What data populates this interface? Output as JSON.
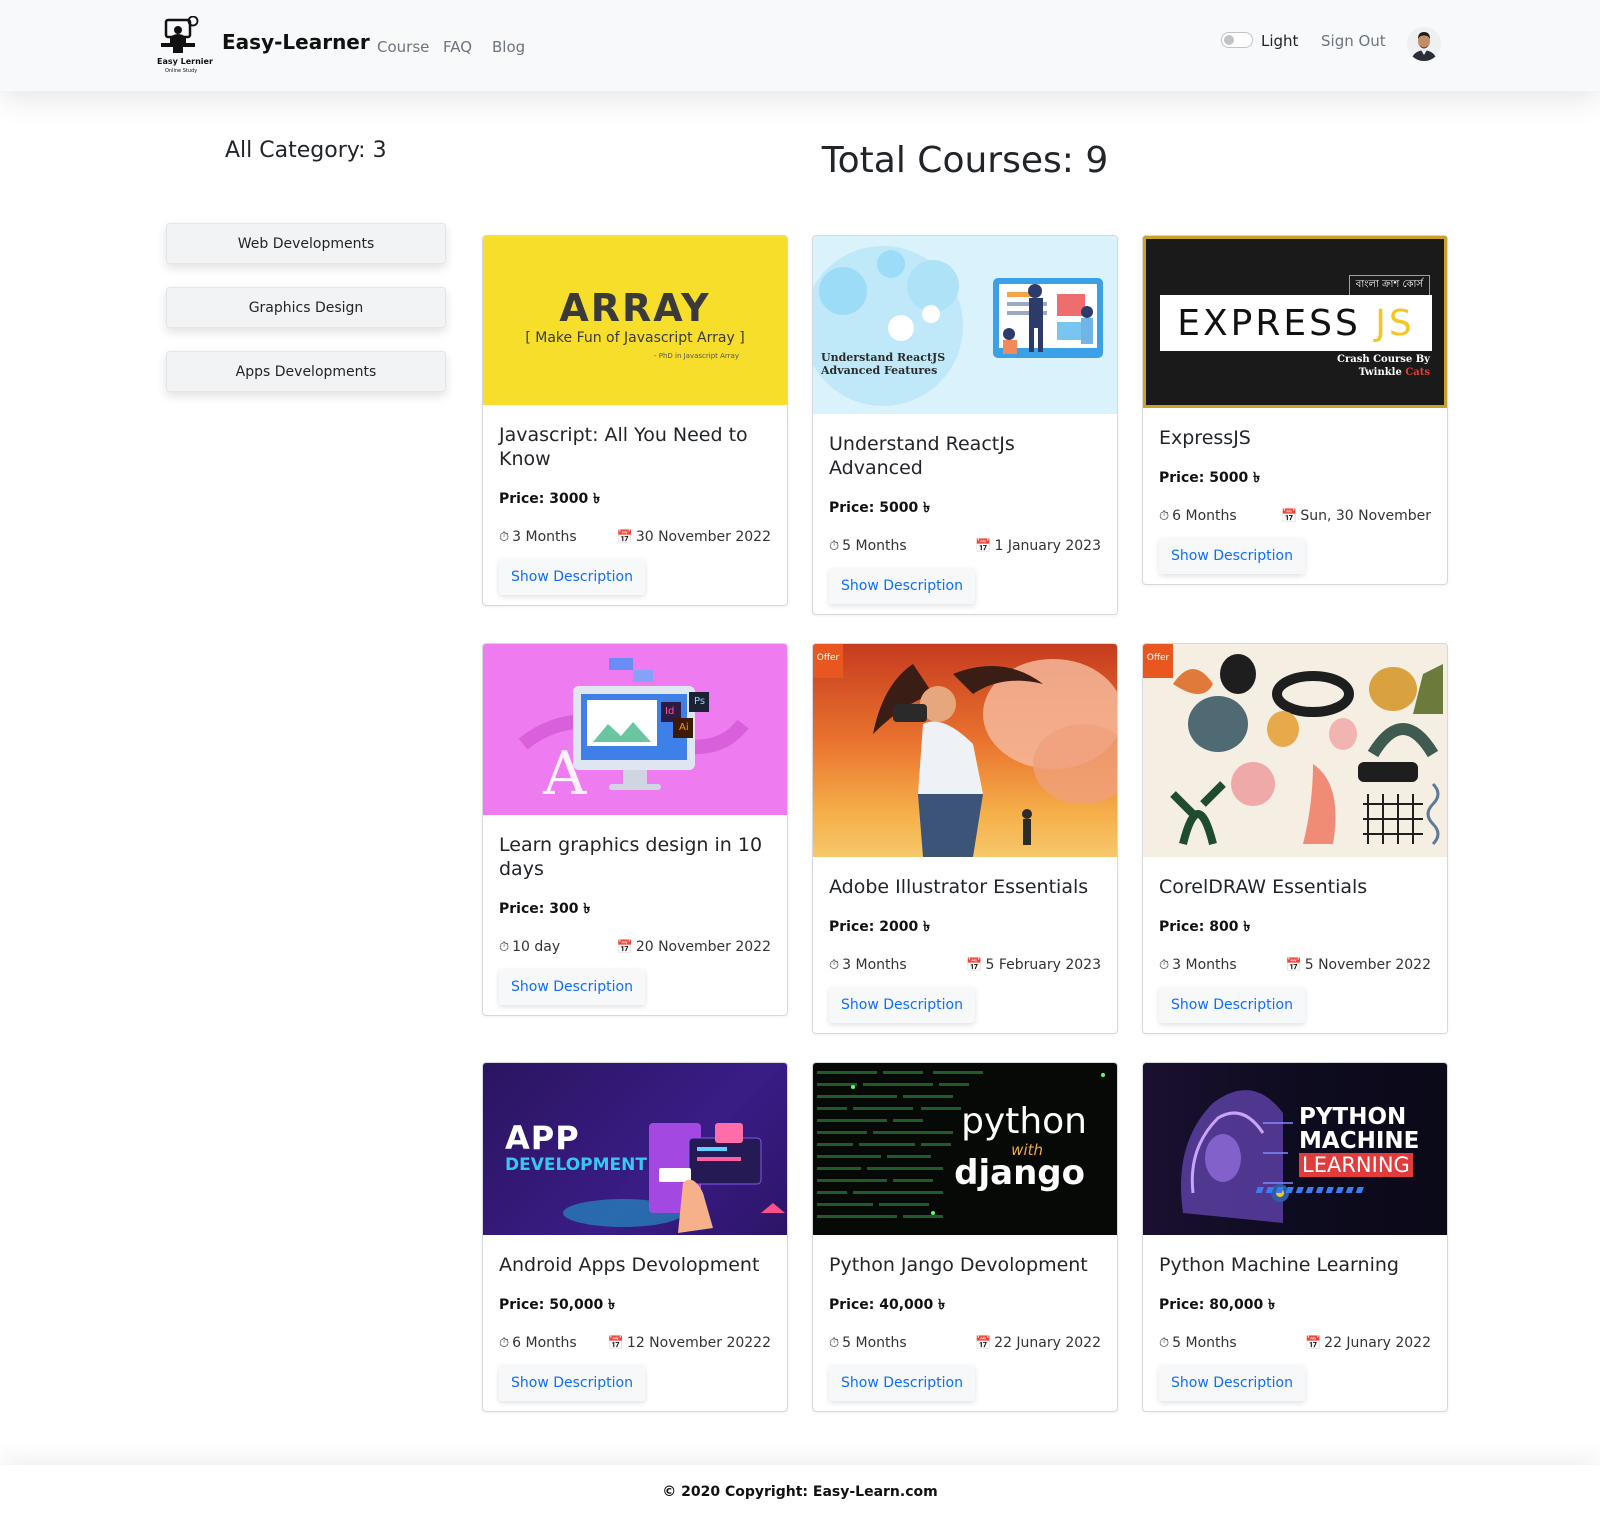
{
  "nav": {
    "brand": "Easy-Learner",
    "logo_line1": "Easy Lernier",
    "logo_line2": "Online Study",
    "links": [
      "Course",
      "FAQ",
      "Blog"
    ],
    "theme_label": "Light",
    "theme_on": false,
    "signout": "Sign Out"
  },
  "sidebar": {
    "category_count": "All Category: 3",
    "categories": [
      "Web Developments",
      "Graphics Design",
      "Apps Developments"
    ]
  },
  "total": "Total Courses: 9",
  "button_label": "Show Description",
  "offer_label": "Offer",
  "courses": [
    {
      "title": "Javascript: All You Need to Know",
      "price": "Price: 3000 ৳",
      "duration": "3 Months",
      "date": "30 November 2022",
      "image": {
        "big": "ARRAY",
        "sub": "[ Make Fun of Javascript Array ]",
        "small": "- PhD in Javascript Array"
      }
    },
    {
      "title": "Understand ReactJs Advanced",
      "price": "Price: 5000 ৳",
      "duration": "5 Months",
      "date": "1 January 2023",
      "image": {
        "line1": "Understand ReactJS",
        "line2": "Advanced Features"
      }
    },
    {
      "title": "ExpressJS",
      "price": "Price: 5000 ৳",
      "duration": "6 Months",
      "date": "Sun, 30 November",
      "image": {
        "badge": "বাংলা ক্রাশ কোর্স",
        "big": "EXPRESS",
        "big_accent": "JS",
        "by1": "Crash Course By",
        "by2": "Twinkle",
        "by2_accent": "Cats"
      }
    },
    {
      "title": "Learn graphics design in 10 days",
      "price": "Price: 300 ৳",
      "duration": "10 day",
      "date": "20 November 2022",
      "image": {
        "ps": "Ps",
        "ai": "Ai",
        "id": "Id"
      }
    },
    {
      "title": "Adobe Illustrator Essentials",
      "price": "Price: 2000 ৳",
      "duration": "3 Months",
      "date": "5 February 2023",
      "offer": true
    },
    {
      "title": "CorelDRAW Essentials",
      "price": "Price: 800 ৳",
      "duration": "3 Months",
      "date": "5 November 2022",
      "offer": true
    },
    {
      "title": "Android Apps Devolopment",
      "price": "Price: 50,000 ৳",
      "duration": "6 Months",
      "date": "12 November 20222",
      "image": {
        "line1": "APP",
        "line2": "DEVELOPMENT"
      }
    },
    {
      "title": "Python Jango Devolopment",
      "price": "Price: 40,000 ৳",
      "duration": "5 Months",
      "date": "22 Junary 2022",
      "image": {
        "line1": "python",
        "line2": "with",
        "line3": "django"
      }
    },
    {
      "title": "Python Machine Learning",
      "price": "Price: 80,000 ৳",
      "duration": "5 Months",
      "date": "22 Junary 2022",
      "image": {
        "line1": "PYTHON",
        "line2": "MACHINE",
        "line3": "LEARNING"
      }
    }
  ],
  "footer": "© 2020 Copyright: Easy-Learn.com",
  "colors": {
    "link": "#0d6efd",
    "navbar_bg": "#f8f9fa",
    "array_yellow": "#f6de2a",
    "offer": "#e8571f"
  }
}
